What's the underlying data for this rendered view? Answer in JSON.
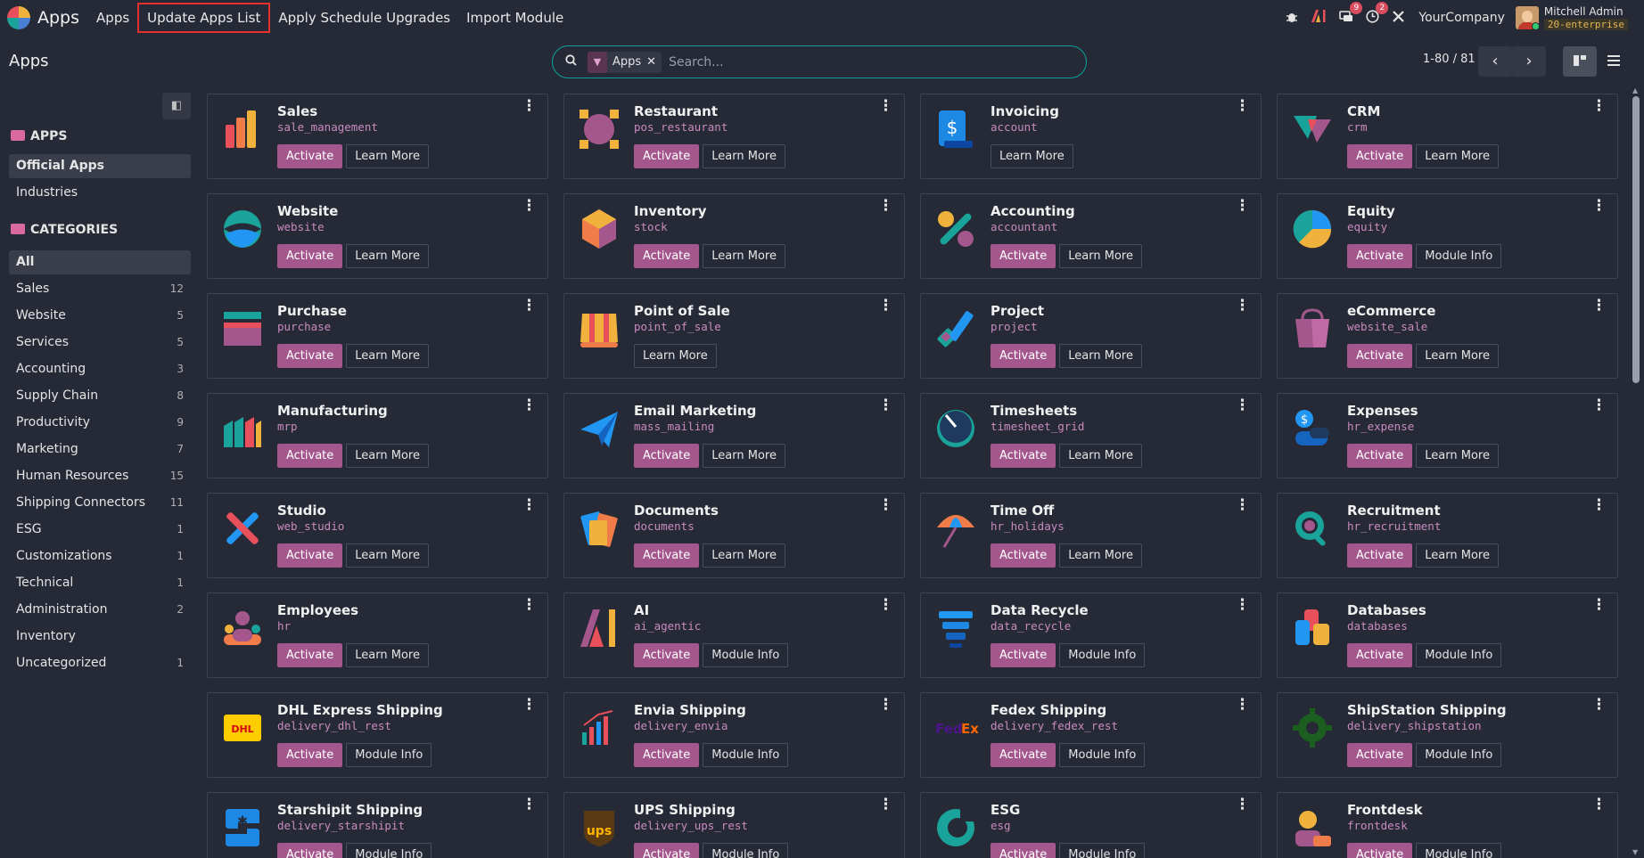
{
  "navbar": {
    "app_name": "Apps",
    "menu": [
      "Apps",
      "Update Apps List",
      "Apply Schedule Upgrades",
      "Import Module"
    ],
    "messages_badge": "9",
    "activities_badge": "2",
    "company": "YourCompany",
    "user_name": "Mitchell Admin",
    "database": "20-enterprise"
  },
  "control_panel": {
    "title": "Apps",
    "search_facet": "Apps",
    "search_placeholder": "Search...",
    "pager": "1-80 / 81"
  },
  "sidebar": {
    "apps_header": "APPS",
    "apps_items": [
      {
        "label": "Official Apps",
        "selected": true
      },
      {
        "label": "Industries",
        "selected": false
      }
    ],
    "categories_header": "CATEGORIES",
    "categories": [
      {
        "label": "All",
        "count": "",
        "selected": true
      },
      {
        "label": "Sales",
        "count": "12"
      },
      {
        "label": "Website",
        "count": "5"
      },
      {
        "label": "Services",
        "count": "5"
      },
      {
        "label": "Accounting",
        "count": "3"
      },
      {
        "label": "Supply Chain",
        "count": "8"
      },
      {
        "label": "Productivity",
        "count": "9"
      },
      {
        "label": "Marketing",
        "count": "7"
      },
      {
        "label": "Human Resources",
        "count": "15"
      },
      {
        "label": "Shipping Connectors",
        "count": "11"
      },
      {
        "label": "ESG",
        "count": "1"
      },
      {
        "label": "Customizations",
        "count": "1"
      },
      {
        "label": "Technical",
        "count": "1"
      },
      {
        "label": "Administration",
        "count": "2"
      },
      {
        "label": "Inventory",
        "count": ""
      },
      {
        "label": "Uncategorized",
        "count": "1"
      }
    ]
  },
  "apps": [
    {
      "name": "Sales",
      "module": "sale_management",
      "activate": "Activate",
      "info": "Learn More",
      "icon": "sales-icon"
    },
    {
      "name": "Restaurant",
      "module": "pos_restaurant",
      "activate": "Activate",
      "info": "Learn More",
      "icon": "restaurant-icon"
    },
    {
      "name": "Invoicing",
      "module": "account",
      "activate": "",
      "info": "Learn More",
      "icon": "invoicing-icon"
    },
    {
      "name": "CRM",
      "module": "crm",
      "activate": "Activate",
      "info": "Learn More",
      "icon": "crm-icon"
    },
    {
      "name": "Website",
      "module": "website",
      "activate": "Activate",
      "info": "Learn More",
      "icon": "website-icon"
    },
    {
      "name": "Inventory",
      "module": "stock",
      "activate": "Activate",
      "info": "Learn More",
      "icon": "inventory-icon"
    },
    {
      "name": "Accounting",
      "module": "accountant",
      "activate": "Activate",
      "info": "Learn More",
      "icon": "accounting-icon"
    },
    {
      "name": "Equity",
      "module": "equity",
      "activate": "Activate",
      "info": "Module Info",
      "icon": "equity-icon"
    },
    {
      "name": "Purchase",
      "module": "purchase",
      "activate": "Activate",
      "info": "Learn More",
      "icon": "purchase-icon"
    },
    {
      "name": "Point of Sale",
      "module": "point_of_sale",
      "activate": "",
      "info": "Learn More",
      "icon": "point-of-sale-icon"
    },
    {
      "name": "Project",
      "module": "project",
      "activate": "Activate",
      "info": "Learn More",
      "icon": "project-icon"
    },
    {
      "name": "eCommerce",
      "module": "website_sale",
      "activate": "Activate",
      "info": "Learn More",
      "icon": "ecommerce-icon"
    },
    {
      "name": "Manufacturing",
      "module": "mrp",
      "activate": "Activate",
      "info": "Learn More",
      "icon": "manufacturing-icon"
    },
    {
      "name": "Email Marketing",
      "module": "mass_mailing",
      "activate": "Activate",
      "info": "Learn More",
      "icon": "email-marketing-icon"
    },
    {
      "name": "Timesheets",
      "module": "timesheet_grid",
      "activate": "Activate",
      "info": "Learn More",
      "icon": "timesheets-icon"
    },
    {
      "name": "Expenses",
      "module": "hr_expense",
      "activate": "Activate",
      "info": "Learn More",
      "icon": "expenses-icon"
    },
    {
      "name": "Studio",
      "module": "web_studio",
      "activate": "Activate",
      "info": "Learn More",
      "icon": "studio-icon"
    },
    {
      "name": "Documents",
      "module": "documents",
      "activate": "Activate",
      "info": "Learn More",
      "icon": "documents-icon"
    },
    {
      "name": "Time Off",
      "module": "hr_holidays",
      "activate": "Activate",
      "info": "Learn More",
      "icon": "time-off-icon"
    },
    {
      "name": "Recruitment",
      "module": "hr_recruitment",
      "activate": "Activate",
      "info": "Learn More",
      "icon": "recruitment-icon"
    },
    {
      "name": "Employees",
      "module": "hr",
      "activate": "Activate",
      "info": "Learn More",
      "icon": "employees-icon"
    },
    {
      "name": "AI",
      "module": "ai_agentic",
      "activate": "Activate",
      "info": "Module Info",
      "icon": "ai-icon"
    },
    {
      "name": "Data Recycle",
      "module": "data_recycle",
      "activate": "Activate",
      "info": "Module Info",
      "icon": "data-recycle-icon"
    },
    {
      "name": "Databases",
      "module": "databases",
      "activate": "Activate",
      "info": "Module Info",
      "icon": "databases-icon"
    },
    {
      "name": "DHL Express Shipping",
      "module": "delivery_dhl_rest",
      "activate": "Activate",
      "info": "Module Info",
      "icon": "dhl-icon"
    },
    {
      "name": "Envia Shipping",
      "module": "delivery_envia",
      "activate": "Activate",
      "info": "Module Info",
      "icon": "envia-icon"
    },
    {
      "name": "Fedex Shipping",
      "module": "delivery_fedex_rest",
      "activate": "Activate",
      "info": "Module Info",
      "icon": "fedex-icon"
    },
    {
      "name": "ShipStation Shipping",
      "module": "delivery_shipstation",
      "activate": "Activate",
      "info": "Module Info",
      "icon": "shipstation-icon"
    },
    {
      "name": "Starshipit Shipping",
      "module": "delivery_starshipit",
      "activate": "Activate",
      "info": "Module Info",
      "icon": "starshipit-icon"
    },
    {
      "name": "UPS Shipping",
      "module": "delivery_ups_rest",
      "activate": "Activate",
      "info": "Module Info",
      "icon": "ups-icon"
    },
    {
      "name": "ESG",
      "module": "esg",
      "activate": "Activate",
      "info": "Module Info",
      "icon": "esg-icon"
    },
    {
      "name": "Frontdesk",
      "module": "frontdesk",
      "activate": "Activate",
      "info": "Module Info",
      "icon": "frontdesk-icon"
    }
  ]
}
